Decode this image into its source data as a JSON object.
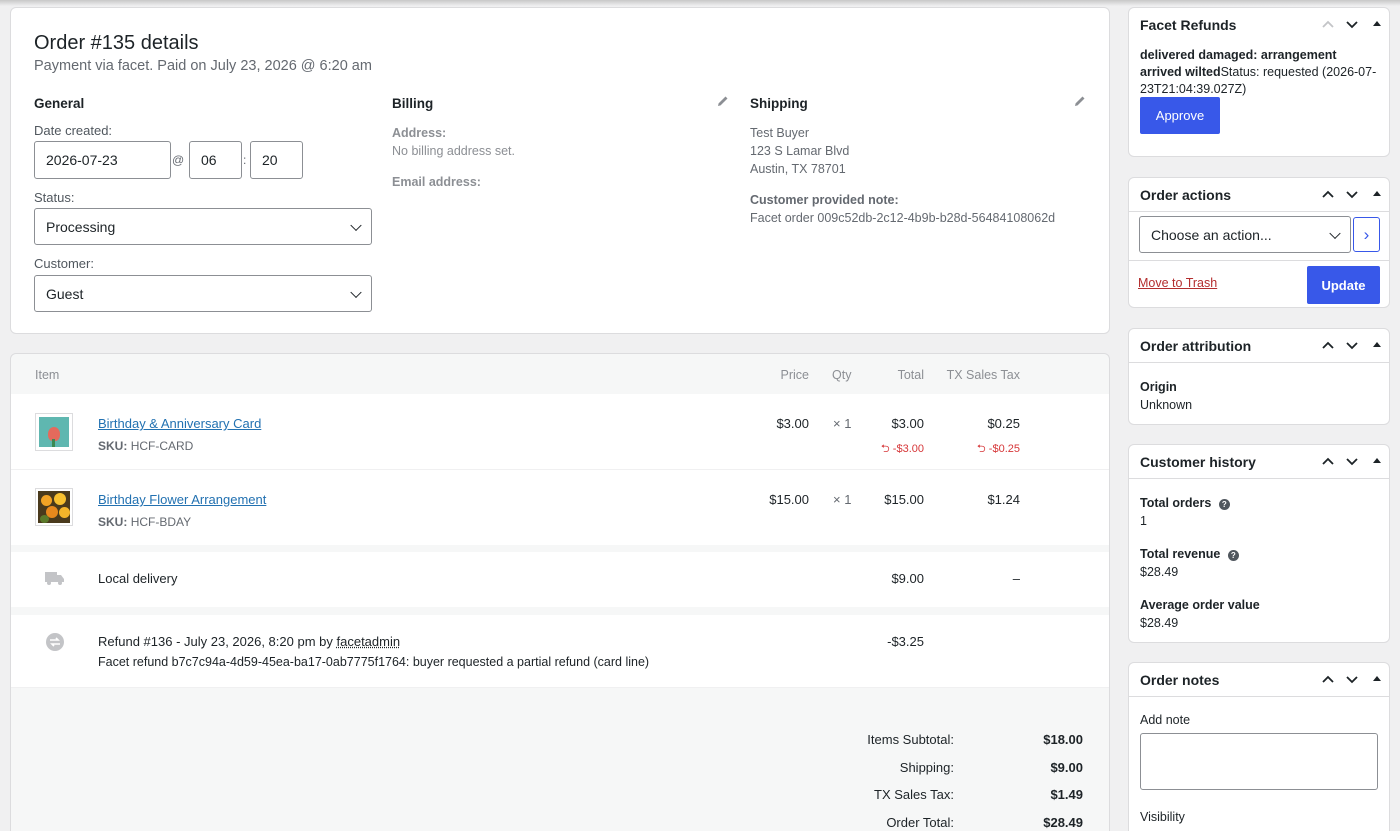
{
  "order": {
    "title": "Order #135 details",
    "subtitle": "Payment via facet. Paid on July 23, 2026 @ 6:20 am",
    "general": {
      "heading": "General",
      "date_label": "Date created:",
      "date": "2026-07-23",
      "at": "@",
      "hour": "06",
      "colon": ":",
      "minute": "20",
      "status_label": "Status:",
      "status": "Processing",
      "customer_label": "Customer:",
      "customer": "Guest"
    },
    "billing": {
      "heading": "Billing",
      "address_label": "Address:",
      "address_value": "No billing address set.",
      "email_label": "Email address:"
    },
    "shipping": {
      "heading": "Shipping",
      "name": "Test Buyer",
      "street": "123 S Lamar Blvd",
      "city": "Austin, TX 78701",
      "note_label": "Customer provided note:",
      "note": "Facet order 009c52db-2c12-4b9b-b28d-56484108062d"
    }
  },
  "items": {
    "headers": {
      "item": "Item",
      "price": "Price",
      "qty": "Qty",
      "total": "Total",
      "tax": "TX Sales Tax"
    },
    "rows": [
      {
        "name": "Birthday & Anniversary Card",
        "sku_label": "SKU:",
        "sku": "HCF-CARD",
        "price": "$3.00",
        "qty": "× 1",
        "total": "$3.00",
        "tax": "$0.25",
        "refund_total": "-$3.00",
        "refund_tax": "-$0.25"
      },
      {
        "name": "Birthday Flower Arrangement",
        "sku_label": "SKU:",
        "sku": "HCF-BDAY",
        "price": "$15.00",
        "qty": "× 1",
        "total": "$15.00",
        "tax": "$1.24"
      }
    ],
    "shipping_line": {
      "name": "Local delivery",
      "total": "$9.00",
      "tax": "–"
    },
    "refund_line": {
      "title_prefix": "Refund #136 - July 23, 2026, 8:20 pm by ",
      "by": "facetadmin",
      "reason": "Facet refund b7c7c94a-4d59-45ea-ba17-0ab7775f1764: buyer requested a partial refund (card line)",
      "amount": "-$3.25"
    },
    "totals": [
      {
        "label": "Items Subtotal:",
        "value": "$18.00"
      },
      {
        "label": "Shipping:",
        "value": "$9.00"
      },
      {
        "label": "TX Sales Tax:",
        "value": "$1.49"
      },
      {
        "label": "Order Total:",
        "value": "$28.49"
      }
    ]
  },
  "sidebar": {
    "refunds": {
      "title": "Facet Refunds",
      "reason": "delivered damaged: arrangement arrived wilted",
      "status": "Status: requested (2026-07-23T21:04:39.027Z)",
      "approve": "Approve"
    },
    "actions": {
      "title": "Order actions",
      "select": "Choose an action...",
      "go": "›",
      "trash": "Move to Trash",
      "update": "Update"
    },
    "attribution": {
      "title": "Order attribution",
      "origin_label": "Origin",
      "origin": "Unknown"
    },
    "history": {
      "title": "Customer history",
      "orders_label": "Total orders",
      "orders": "1",
      "revenue_label": "Total revenue",
      "revenue": "$28.49",
      "aov_label": "Average order value",
      "aov": "$28.49"
    },
    "notes": {
      "title": "Order notes",
      "add_label": "Add note",
      "visibility_label": "Visibility"
    }
  },
  "colors": {
    "accent": "#3858e9",
    "link": "#2271b1",
    "danger": "#d63638",
    "trash": "#b32d2e"
  }
}
